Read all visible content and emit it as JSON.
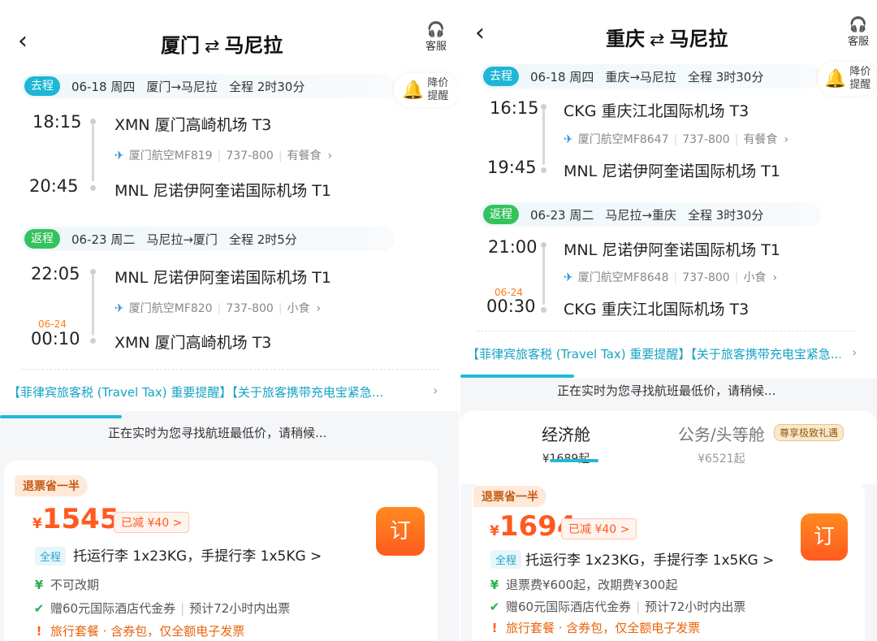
{
  "left": {
    "header": {
      "title_from": "厦门",
      "title_swap": "⇄",
      "title_to": "马尼拉",
      "cs_label": "客服"
    },
    "outbound": {
      "tag": "去程",
      "date": "06-18 周四",
      "route": "厦门→马尼拉",
      "duration": "全程 2时30分",
      "dep_time": "18:15",
      "dep_airport": "XMN 厦门高崎机场 T3",
      "flight": "厦门航空MF819",
      "aircraft": "737-800",
      "meal": "有餐食",
      "arr_time": "20:45",
      "arr_airport": "MNL 尼诺伊阿奎诺国际机场 T1"
    },
    "remind": {
      "line1": "降价",
      "line2": "提醒"
    },
    "inbound": {
      "tag": "返程",
      "date": "06-23 周二",
      "route": "马尼拉→厦门",
      "duration": "全程 2时5分",
      "dep_time": "22:05",
      "dep_airport": "MNL 尼诺伊阿奎诺国际机场 T1",
      "flight": "厦门航空MF820",
      "aircraft": "737-800",
      "meal": "小食",
      "arr_next_day": "06-24",
      "arr_time": "00:10",
      "arr_airport": "XMN 厦门高崎机场 T3"
    },
    "notice": "【菲律宾旅客税 (Travel Tax) 重要提醒】【关于旅客携带充电宝紧急...",
    "searching": "正在实时为您寻找航班最低价，请稍候...",
    "offer": {
      "badge": "退票省一半",
      "currency": "¥",
      "price": "1545",
      "discount": "已减 ¥40 >",
      "book": "订",
      "full_tag": "全程",
      "baggage": "托运行李 1x23KG，手提行李 1x5KG >",
      "rule1": "不可改期",
      "rule2a": "赠60元国际酒店代金券",
      "rule2b": "预计72小时内出票",
      "rule3": "旅行套餐 · 含券包，仅全额电子发票"
    }
  },
  "right": {
    "header": {
      "title_from": "重庆",
      "title_swap": "⇄",
      "title_to": "马尼拉",
      "cs_label": "客服"
    },
    "outbound": {
      "tag": "去程",
      "date": "06-18 周四",
      "route": "重庆→马尼拉",
      "duration": "全程 3时30分",
      "dep_time": "16:15",
      "dep_airport": "CKG 重庆江北国际机场 T3",
      "flight": "厦门航空MF8647",
      "aircraft": "737-800",
      "meal": "有餐食",
      "arr_time": "19:45",
      "arr_airport": "MNL 尼诺伊阿奎诺国际机场 T1"
    },
    "remind": {
      "line1": "降价",
      "line2": "提醒"
    },
    "inbound": {
      "tag": "返程",
      "date": "06-23 周二",
      "route": "马尼拉→重庆",
      "duration": "全程 3时30分",
      "dep_time": "21:00",
      "dep_airport": "MNL 尼诺伊阿奎诺国际机场 T1",
      "flight": "厦门航空MF8648",
      "aircraft": "737-800",
      "meal": "小食",
      "arr_next_day": "06-24",
      "arr_time": "00:30",
      "arr_airport": "CKG 重庆江北国际机场 T3"
    },
    "notice": "【菲律宾旅客税 (Travel Tax) 重要提醒】【关于旅客携带充电宝紧急...",
    "searching": "正在实时为您寻找航班最低价，请稍候...",
    "cabins": {
      "economy": "经济舱",
      "economy_price": "¥1689起",
      "business": "公务/头等舱",
      "business_price": "¥6521起",
      "perk": "尊享极致礼遇"
    },
    "offer": {
      "badge": "退票省一半",
      "currency": "¥",
      "price": "1694",
      "discount": "已减 ¥40 >",
      "book": "订",
      "full_tag": "全程",
      "baggage": "托运行李 1x23KG，手提行李 1x5KG >",
      "rule1": "退票费¥600起，改期费¥300起",
      "rule2a": "赠60元国际酒店代金券",
      "rule2b": "预计72小时内出票",
      "rule3": "旅行套餐 · 含券包，仅全额电子发票"
    }
  },
  "icons": {
    "back": "back-arrow-icon",
    "cs": "headset-icon",
    "bell": "bell-icon",
    "plane": "airline-logo-icon",
    "chevron": "chevron-right-icon",
    "yen": "yen-icon",
    "check": "check-icon",
    "alert": "alert-icon"
  }
}
